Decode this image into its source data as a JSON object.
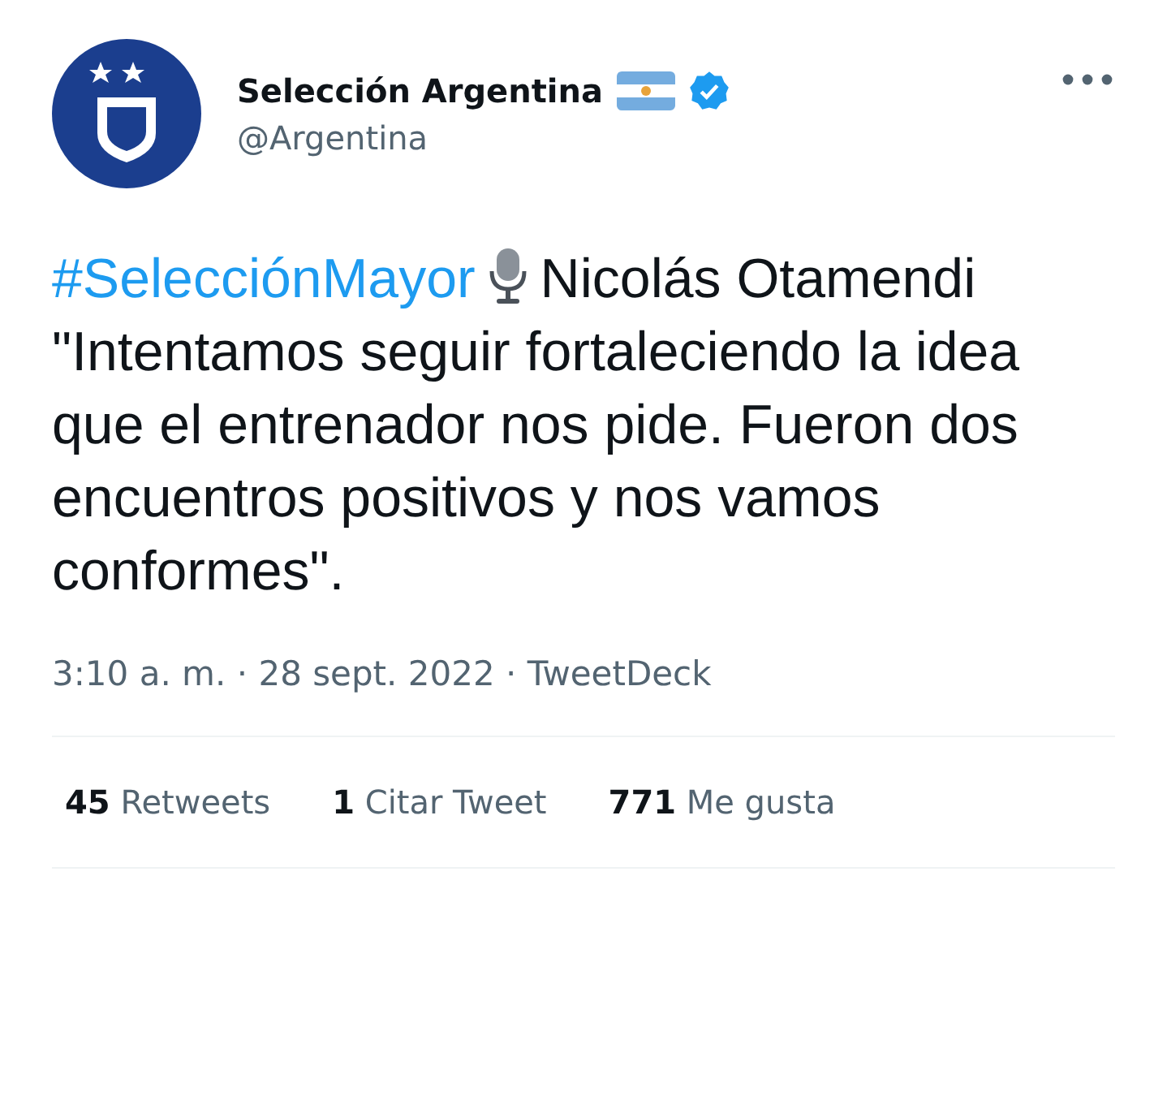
{
  "author": {
    "name": "Selección Argentina",
    "verified": true,
    "handle": "@Argentina"
  },
  "tweet": {
    "hashtag": "#SelecciónMayor",
    "text": "Nicolás Otamendi \"Intentamos seguir fortaleciendo la idea que el entrenador nos pide. Fueron dos encuentros positivos y nos vamos conformes\"."
  },
  "meta": {
    "line": "3:10 a. m. · 28 sept. 2022 · TweetDeck"
  },
  "stats": [
    {
      "count": "45",
      "label": "Retweets"
    },
    {
      "count": "1",
      "label": "Citar Tweet"
    },
    {
      "count": "771",
      "label": "Me gusta"
    }
  ]
}
